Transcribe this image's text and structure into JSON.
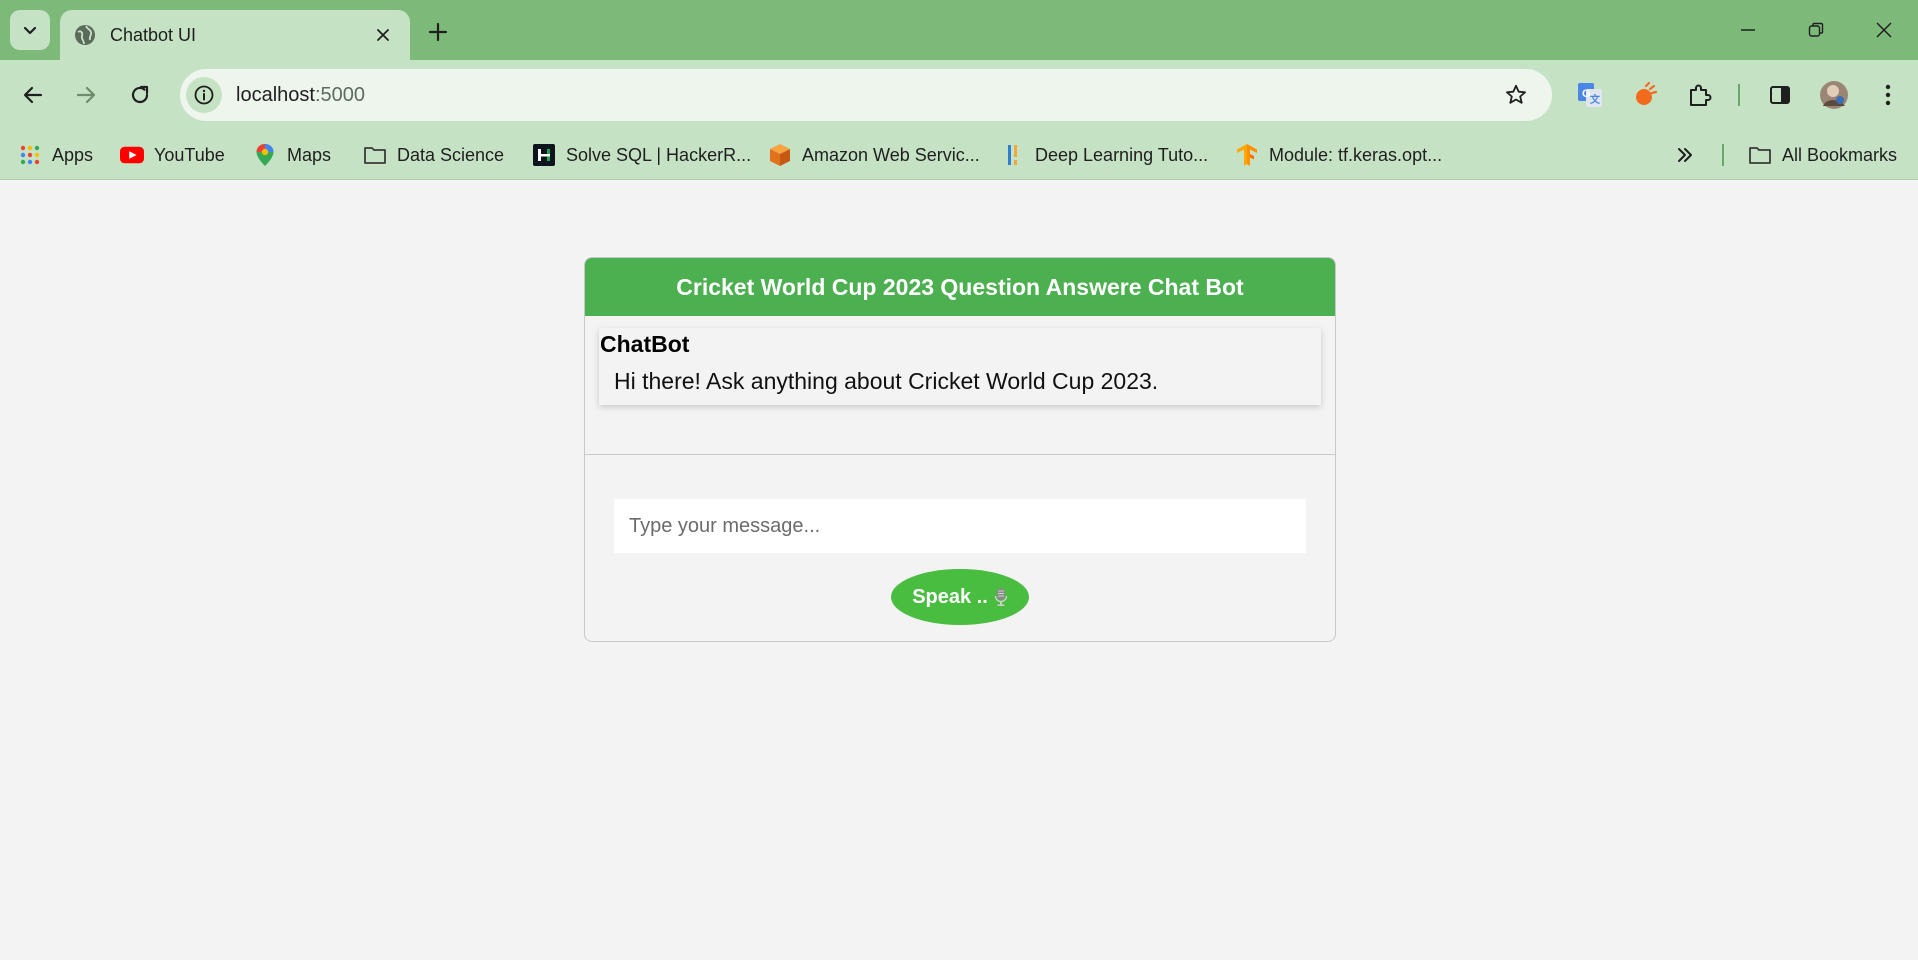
{
  "browser": {
    "tab": {
      "title": "Chatbot UI"
    },
    "address_bar": {
      "host": "localhost",
      "port": ":5000"
    },
    "bookmarks": [
      {
        "label": "Apps",
        "icon": "apps-grid-icon"
      },
      {
        "label": "YouTube",
        "icon": "youtube-icon"
      },
      {
        "label": "Maps",
        "icon": "maps-pin-icon"
      },
      {
        "label": "Data Science",
        "icon": "folder-icon"
      },
      {
        "label": "Solve SQL | HackerR...",
        "icon": "hackerrank-icon"
      },
      {
        "label": "Amazon Web Servic...",
        "icon": "aws-cube-icon"
      },
      {
        "label": "Deep Learning Tuto...",
        "icon": "deep-learning-icon"
      },
      {
        "label": "Module: tf.keras.opt...",
        "icon": "tensorflow-icon"
      }
    ],
    "all_bookmarks_label": "All Bookmarks"
  },
  "chat": {
    "header_title": "Cricket World Cup 2023 Question Answere Chat Bot",
    "messages": [
      {
        "sender": "ChatBot",
        "text": "Hi there! Ask anything about Cricket World Cup 2023."
      }
    ],
    "input": {
      "placeholder": "Type your message...",
      "value": ""
    },
    "speak_button": {
      "label": "Speak ..",
      "icon": "microphone-icon"
    }
  },
  "colors": {
    "titlebar": "#7dba7a",
    "toolbar": "#c6e2c4",
    "header": "#4caf50",
    "speak_button": "#49bd3f",
    "page_background": "#f3f3f3"
  }
}
